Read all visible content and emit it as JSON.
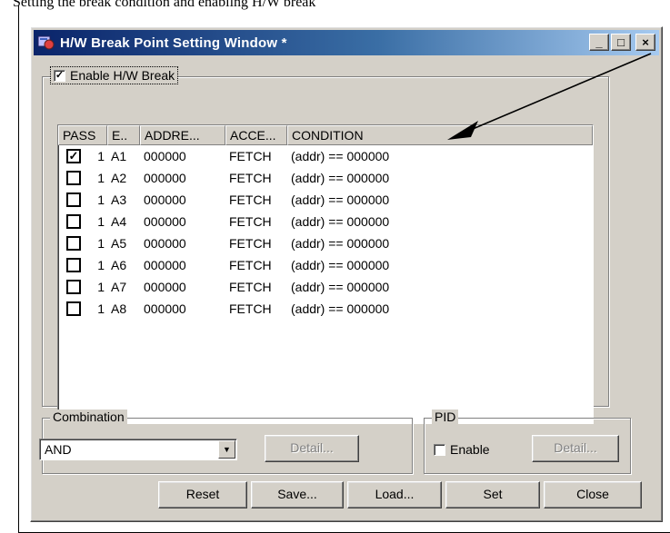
{
  "doc": {
    "top_text": "Setting the break condition and enabling H/W break"
  },
  "window": {
    "title": "H/W Break Point Setting Window *",
    "controls": {
      "minimize": "_",
      "maximize": "□",
      "close": "×"
    }
  },
  "enable_hw_break": {
    "label": "Enable H/W Break",
    "checked": true
  },
  "table": {
    "columns": [
      "PASS",
      "E..",
      "ADDRE...",
      "ACCE...",
      "CONDITION"
    ],
    "rows": [
      {
        "checked": true,
        "pass": "1",
        "event": "A1",
        "address": "000000",
        "access": "FETCH",
        "condition": "(addr) == 000000"
      },
      {
        "checked": false,
        "pass": "1",
        "event": "A2",
        "address": "000000",
        "access": "FETCH",
        "condition": "(addr) == 000000"
      },
      {
        "checked": false,
        "pass": "1",
        "event": "A3",
        "address": "000000",
        "access": "FETCH",
        "condition": "(addr) == 000000"
      },
      {
        "checked": false,
        "pass": "1",
        "event": "A4",
        "address": "000000",
        "access": "FETCH",
        "condition": "(addr) == 000000"
      },
      {
        "checked": false,
        "pass": "1",
        "event": "A5",
        "address": "000000",
        "access": "FETCH",
        "condition": "(addr) == 000000"
      },
      {
        "checked": false,
        "pass": "1",
        "event": "A6",
        "address": "000000",
        "access": "FETCH",
        "condition": "(addr) == 000000"
      },
      {
        "checked": false,
        "pass": "1",
        "event": "A7",
        "address": "000000",
        "access": "FETCH",
        "condition": "(addr) == 000000"
      },
      {
        "checked": false,
        "pass": "1",
        "event": "A8",
        "address": "000000",
        "access": "FETCH",
        "condition": "(addr) == 000000"
      }
    ]
  },
  "combination": {
    "label": "Combination",
    "value": "AND",
    "detail_label": "Detail..."
  },
  "pid": {
    "label": "PID",
    "enable_label": "Enable",
    "enable_checked": false,
    "detail_label": "Detail..."
  },
  "buttons": {
    "reset": "Reset",
    "save": "Save...",
    "load": "Load...",
    "set": "Set",
    "close": "Close"
  },
  "icons": {
    "window_icon": "hw-break-app-icon",
    "check_mark": "✓",
    "dropdown": "▼"
  },
  "colors": {
    "title_start": "#0a246a",
    "title_end": "#a6caf0",
    "face": "#d4d0c8"
  }
}
